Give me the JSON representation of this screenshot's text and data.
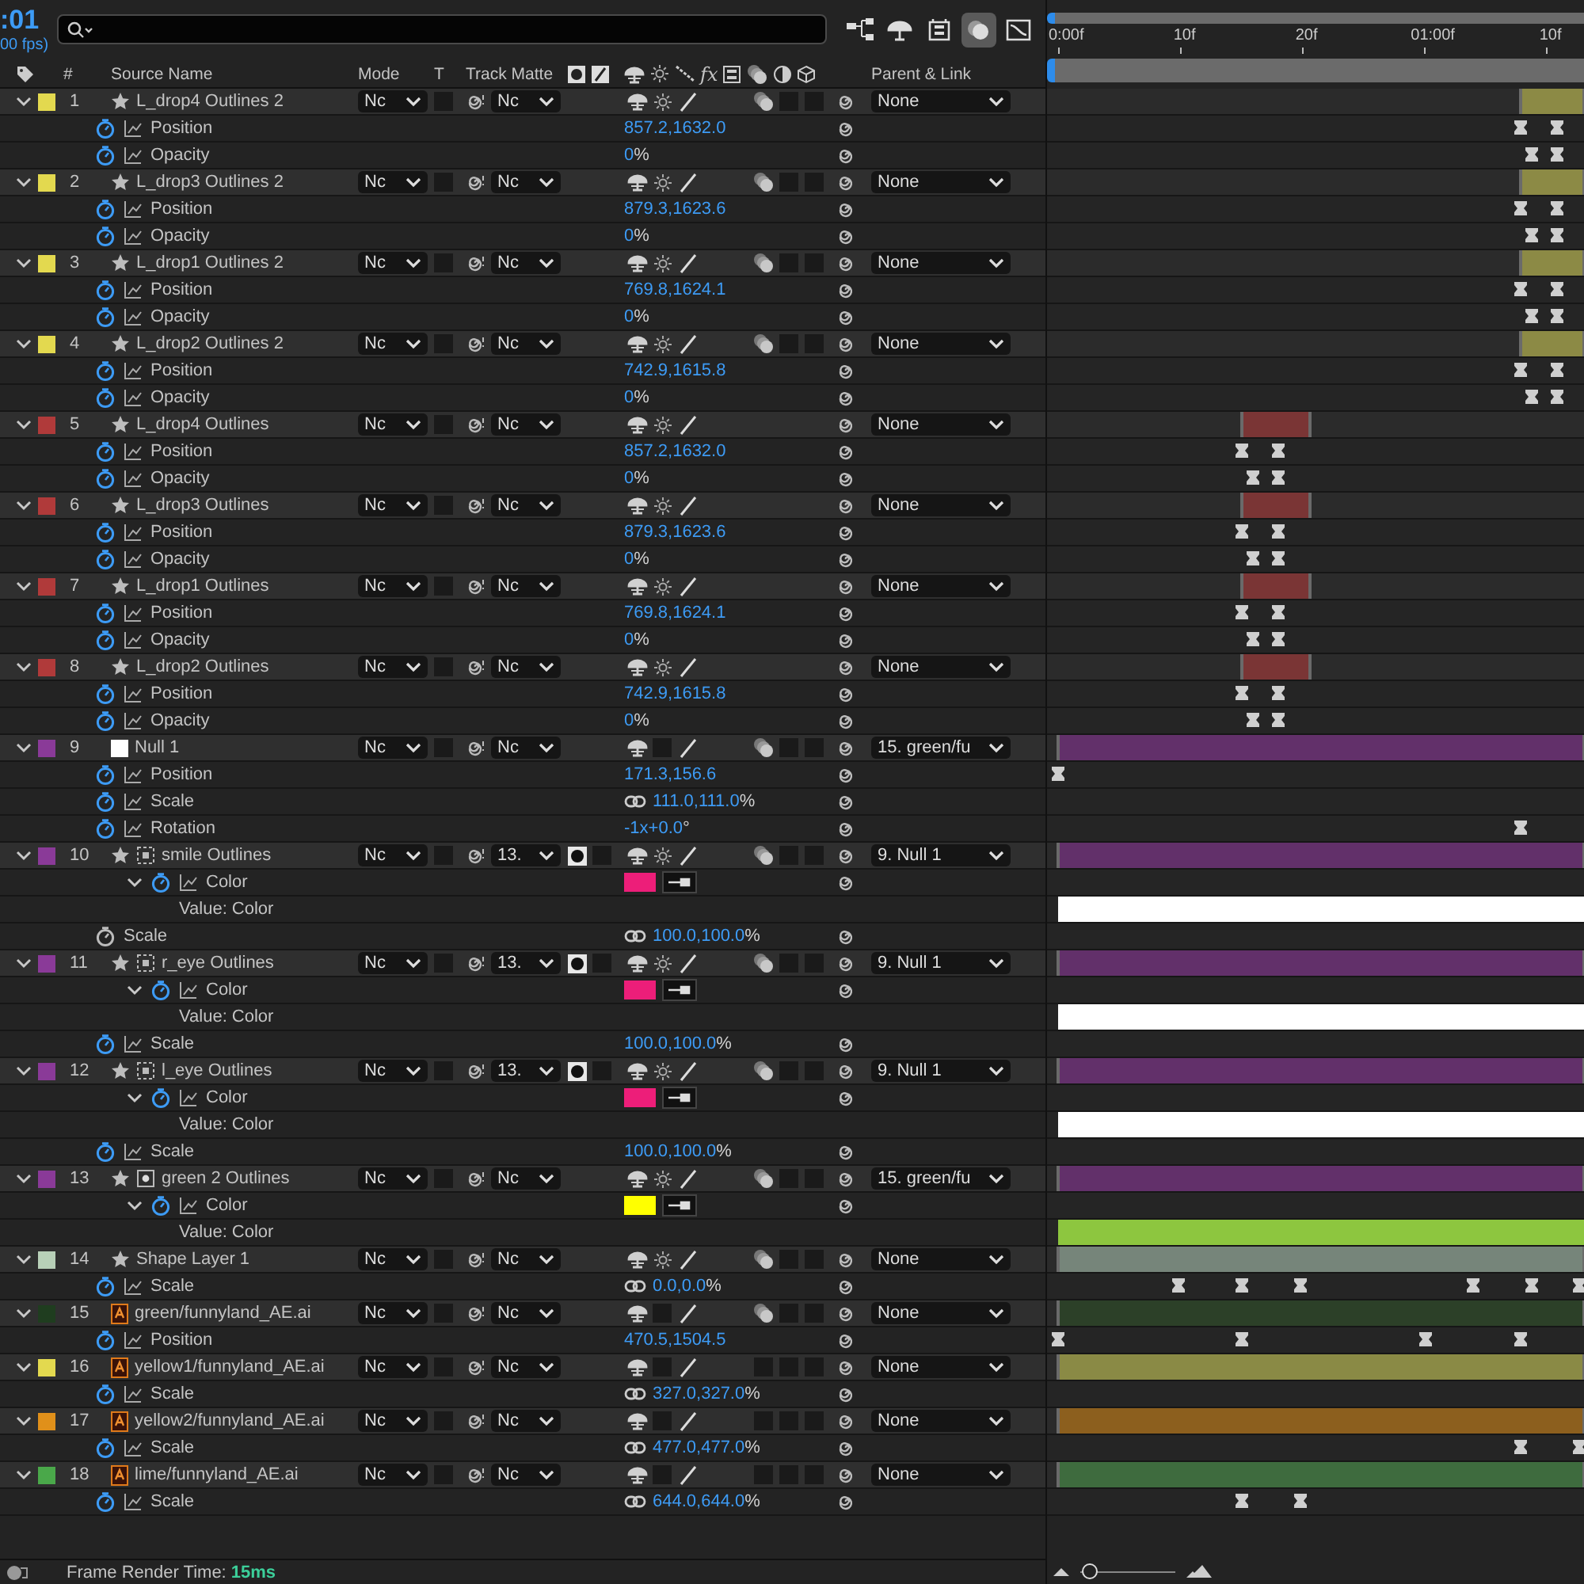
{
  "time": {
    "current": ":01",
    "fps": "00 fps)"
  },
  "toolbar": [
    {
      "selected": false
    },
    {
      "selected": false
    },
    {
      "selected": false
    },
    {
      "selected": true
    },
    {
      "selected": false
    }
  ],
  "columns": {
    "number": "#",
    "source_name": "Source Name",
    "mode": "Mode",
    "t": "T",
    "track_matte": "Track Matte",
    "fx": "fx",
    "parent": "Parent & Link"
  },
  "ruler": [
    "0:00f",
    "10f",
    "20f",
    "01:00f",
    "10f"
  ],
  "layers": [
    {
      "number": "1",
      "name": "L_drop4 Outlines 2",
      "color": "#e3d94f",
      "kind": "shape",
      "expanded": true,
      "mode": "Nc",
      "track_matte": "Nc",
      "matte_set": false,
      "collapse": true,
      "extra_switches": true,
      "motion_blur": true,
      "parent": "None",
      "bar": {
        "color": "#8c8a45",
        "in": {
          "level": 0.88
        },
        "out": {
          "level": 1
        }
      },
      "properties": [
        {
          "name": "Position",
          "kind": "property",
          "animated": true,
          "linked": false,
          "value": "857.2,1632.0",
          "keyframes": [
            {
              "level": 0.88
            },
            {
              "level": 0.95
            }
          ]
        },
        {
          "name": "Opacity",
          "kind": "property",
          "animated": true,
          "linked": false,
          "value": "0",
          "unit": "%",
          "keyframes": [
            {
              "level": 0.9
            },
            {
              "level": 0.95
            }
          ]
        }
      ]
    },
    {
      "number": "2",
      "name": "L_drop3 Outlines 2",
      "color": "#e3d94f",
      "kind": "shape",
      "expanded": true,
      "mode": "Nc",
      "track_matte": "Nc",
      "matte_set": false,
      "collapse": true,
      "extra_switches": true,
      "motion_blur": true,
      "parent": "None",
      "bar": {
        "color": "#8c8a45",
        "in": {
          "level": 0.88
        },
        "out": {
          "level": 1
        }
      },
      "properties": [
        {
          "name": "Position",
          "kind": "property",
          "animated": true,
          "linked": false,
          "value": "879.3,1623.6",
          "keyframes": [
            {
              "level": 0.88
            },
            {
              "level": 0.95
            }
          ]
        },
        {
          "name": "Opacity",
          "kind": "property",
          "animated": true,
          "linked": false,
          "value": "0",
          "unit": "%",
          "keyframes": [
            {
              "level": 0.9
            },
            {
              "level": 0.95
            }
          ]
        }
      ]
    },
    {
      "number": "3",
      "name": "L_drop1 Outlines 2",
      "color": "#e3d94f",
      "kind": "shape",
      "expanded": true,
      "mode": "Nc",
      "track_matte": "Nc",
      "matte_set": false,
      "collapse": true,
      "extra_switches": true,
      "motion_blur": true,
      "parent": "None",
      "bar": {
        "color": "#8c8a45",
        "in": {
          "level": 0.88
        },
        "out": {
          "level": 1
        }
      },
      "properties": [
        {
          "name": "Position",
          "kind": "property",
          "animated": true,
          "linked": false,
          "value": "769.8,1624.1",
          "keyframes": [
            {
              "level": 0.88
            },
            {
              "level": 0.95
            }
          ]
        },
        {
          "name": "Opacity",
          "kind": "property",
          "animated": true,
          "linked": false,
          "value": "0",
          "unit": "%",
          "keyframes": [
            {
              "level": 0.9
            },
            {
              "level": 0.95
            }
          ]
        }
      ]
    },
    {
      "number": "4",
      "name": "L_drop2 Outlines 2",
      "color": "#e3d94f",
      "kind": "shape",
      "expanded": true,
      "mode": "Nc",
      "track_matte": "Nc",
      "matte_set": false,
      "collapse": true,
      "extra_switches": true,
      "motion_blur": true,
      "parent": "None",
      "bar": {
        "color": "#8c8a45",
        "in": {
          "level": 0.88
        },
        "out": {
          "level": 1
        }
      },
      "properties": [
        {
          "name": "Position",
          "kind": "property",
          "animated": true,
          "linked": false,
          "value": "742.9,1615.8",
          "keyframes": [
            {
              "level": 0.88
            },
            {
              "level": 0.95
            }
          ]
        },
        {
          "name": "Opacity",
          "kind": "property",
          "animated": true,
          "linked": false,
          "value": "0",
          "unit": "%",
          "keyframes": [
            {
              "level": 0.9
            },
            {
              "level": 0.95
            }
          ]
        }
      ]
    },
    {
      "number": "5",
      "name": "L_drop4 Outlines",
      "color": "#b03a3a",
      "kind": "shape",
      "expanded": true,
      "mode": "Nc",
      "track_matte": "Nc",
      "matte_set": false,
      "collapse": true,
      "extra_switches": false,
      "parent": "None",
      "bar": {
        "color": "#7a3535",
        "in": {
          "level": 0.35
        },
        "out": {
          "level": 0.48
        }
      },
      "properties": [
        {
          "name": "Position",
          "kind": "property",
          "animated": true,
          "linked": false,
          "value": "857.2,1632.0",
          "keyframes": [
            {
              "level": 0.35
            },
            {
              "level": 0.42
            }
          ]
        },
        {
          "name": "Opacity",
          "kind": "property",
          "animated": true,
          "linked": false,
          "value": "0",
          "unit": "%",
          "keyframes": [
            {
              "level": 0.37
            },
            {
              "level": 0.42
            }
          ]
        }
      ]
    },
    {
      "number": "6",
      "name": "L_drop3 Outlines",
      "color": "#b03a3a",
      "kind": "shape",
      "expanded": true,
      "mode": "Nc",
      "track_matte": "Nc",
      "matte_set": false,
      "collapse": true,
      "extra_switches": false,
      "parent": "None",
      "bar": {
        "color": "#7a3535",
        "in": {
          "level": 0.35
        },
        "out": {
          "level": 0.48
        }
      },
      "properties": [
        {
          "name": "Position",
          "kind": "property",
          "animated": true,
          "linked": false,
          "value": "879.3,1623.6",
          "keyframes": [
            {
              "level": 0.35
            },
            {
              "level": 0.42
            }
          ]
        },
        {
          "name": "Opacity",
          "kind": "property",
          "animated": true,
          "linked": false,
          "value": "0",
          "unit": "%",
          "keyframes": [
            {
              "level": 0.37
            },
            {
              "level": 0.42
            }
          ]
        }
      ]
    },
    {
      "number": "7",
      "name": "L_drop1 Outlines",
      "color": "#b03a3a",
      "kind": "shape",
      "expanded": true,
      "mode": "Nc",
      "track_matte": "Nc",
      "matte_set": false,
      "collapse": true,
      "extra_switches": false,
      "parent": "None",
      "bar": {
        "color": "#7a3535",
        "in": {
          "level": 0.35
        },
        "out": {
          "level": 0.48
        }
      },
      "properties": [
        {
          "name": "Position",
          "kind": "property",
          "animated": true,
          "linked": false,
          "value": "769.8,1624.1",
          "keyframes": [
            {
              "level": 0.35
            },
            {
              "level": 0.42
            }
          ]
        },
        {
          "name": "Opacity",
          "kind": "property",
          "animated": true,
          "linked": false,
          "value": "0",
          "unit": "%",
          "keyframes": [
            {
              "level": 0.37
            },
            {
              "level": 0.42
            }
          ]
        }
      ]
    },
    {
      "number": "8",
      "name": "L_drop2 Outlines",
      "color": "#b03a3a",
      "kind": "shape",
      "expanded": true,
      "mode": "Nc",
      "track_matte": "Nc",
      "matte_set": false,
      "collapse": true,
      "extra_switches": false,
      "parent": "None",
      "bar": {
        "color": "#7a3535",
        "in": {
          "level": 0.35
        },
        "out": {
          "level": 0.48
        }
      },
      "properties": [
        {
          "name": "Position",
          "kind": "property",
          "animated": true,
          "linked": false,
          "value": "742.9,1615.8",
          "keyframes": [
            {
              "level": 0.35
            },
            {
              "level": 0.42
            }
          ]
        },
        {
          "name": "Opacity",
          "kind": "property",
          "animated": true,
          "linked": false,
          "value": "0",
          "unit": "%",
          "keyframes": [
            {
              "level": 0.37
            },
            {
              "level": 0.42
            }
          ]
        }
      ]
    },
    {
      "number": "9",
      "name": "Null 1",
      "color": "#8a3a98",
      "kind": "null",
      "expanded": true,
      "mode": "Nc",
      "track_matte": "Nc",
      "matte_set": false,
      "collapse": false,
      "extra_switches": true,
      "motion_blur": true,
      "parent": "15. green/fu",
      "bar": {
        "color": "#62306a",
        "in": {
          "level": 0
        },
        "out": {
          "level": 1
        }
      },
      "properties": [
        {
          "name": "Position",
          "kind": "property",
          "animated": true,
          "linked": false,
          "value": "171.3,156.6",
          "keyframes": [
            {
              "level": 0
            }
          ]
        },
        {
          "name": "Scale",
          "kind": "property",
          "animated": true,
          "linked": true,
          "value": "111.0,111.0",
          "unit": "%"
        },
        {
          "name": "Rotation",
          "kind": "property",
          "animated": true,
          "linked": false,
          "value": "-1x+0.0",
          "unit": "°",
          "keyframes": [
            {
              "level": 0.88
            }
          ]
        }
      ]
    },
    {
      "number": "10",
      "name": "smile Outlines",
      "color": "#8a3a98",
      "kind": "shape-alpha",
      "expanded": true,
      "mode": "Nc",
      "track_matte": "13.",
      "matte_set": true,
      "collapse": true,
      "extra_switches": true,
      "motion_blur": true,
      "parent": "9. Null 1",
      "bar": {
        "color": "#62306a",
        "in": {
          "level": 0
        },
        "out": {
          "level": 1
        }
      },
      "properties": [
        {
          "name": "Color",
          "kind": "color",
          "animated": true,
          "expanded": true,
          "color": "#ed1e79"
        },
        {
          "name": "Value: Color",
          "kind": "value-label",
          "value_bar": {
            "color": "#ffffff"
          }
        },
        {
          "name": "Scale",
          "kind": "property",
          "animated": false,
          "linked": true,
          "value": "100.0,100.0",
          "unit": "%"
        }
      ]
    },
    {
      "number": "11",
      "name": "r_eye Outlines",
      "color": "#8a3a98",
      "kind": "shape-alpha",
      "expanded": true,
      "mode": "Nc",
      "track_matte": "13.",
      "matte_set": true,
      "collapse": true,
      "extra_switches": true,
      "motion_blur": true,
      "parent": "9. Null 1",
      "bar": {
        "color": "#62306a",
        "in": {
          "level": 0
        },
        "out": {
          "level": 1
        }
      },
      "properties": [
        {
          "name": "Color",
          "kind": "color",
          "animated": true,
          "expanded": true,
          "color": "#ed1e79"
        },
        {
          "name": "Value: Color",
          "kind": "value-label",
          "value_bar": {
            "color": "#ffffff"
          }
        },
        {
          "name": "Scale",
          "kind": "property",
          "animated": true,
          "linked": false,
          "value": "100.0,100.0",
          "unit": "%"
        }
      ]
    },
    {
      "number": "12",
      "name": "l_eye Outlines",
      "color": "#8a3a98",
      "kind": "shape-alpha",
      "expanded": true,
      "mode": "Nc",
      "track_matte": "13.",
      "matte_set": true,
      "collapse": true,
      "extra_switches": true,
      "motion_blur": true,
      "parent": "9. Null 1",
      "bar": {
        "color": "#62306a",
        "in": {
          "level": 0
        },
        "out": {
          "level": 1
        }
      },
      "properties": [
        {
          "name": "Color",
          "kind": "color",
          "animated": true,
          "expanded": true,
          "color": "#ed1e79"
        },
        {
          "name": "Value: Color",
          "kind": "value-label",
          "value_bar": {
            "color": "#ffffff"
          }
        },
        {
          "name": "Scale",
          "kind": "property",
          "animated": true,
          "linked": false,
          "value": "100.0,100.0",
          "unit": "%"
        }
      ]
    },
    {
      "number": "13",
      "name": "green 2 Outlines",
      "color": "#8a3a98",
      "kind": "shape-matte",
      "expanded": true,
      "mode": "Nc",
      "track_matte": "Nc",
      "matte_set": false,
      "collapse": true,
      "extra_switches": true,
      "motion_blur": true,
      "parent": "15. green/fu",
      "bar": {
        "color": "#62306a",
        "in": {
          "level": 0
        },
        "out": {
          "level": 1
        }
      },
      "properties": [
        {
          "name": "Color",
          "kind": "color",
          "animated": true,
          "expanded": true,
          "color": "#ffff00"
        },
        {
          "name": "Value: Color",
          "kind": "value-label",
          "value_bar": {
            "color": "#8dc63f"
          }
        }
      ]
    },
    {
      "number": "14",
      "name": "Shape Layer 1",
      "color": "#b8d0b8",
      "kind": "shape",
      "expanded": true,
      "mode": "Nc",
      "track_matte": "Nc",
      "matte_set": false,
      "collapse": true,
      "extra_switches": true,
      "motion_blur": true,
      "parent": "None",
      "bar": {
        "color": "#76857a",
        "in": {
          "level": 0
        },
        "out": {
          "level": 1
        }
      },
      "properties": [
        {
          "name": "Scale",
          "kind": "property",
          "animated": true,
          "linked": true,
          "value": "0.0,0.0",
          "unit": "%",
          "keyframes": [
            {
              "level": 0.23
            },
            {
              "level": 0.35
            },
            {
              "level": 0.46
            },
            {
              "level": 0.79
            },
            {
              "level": 0.9
            },
            {
              "level": 0.99
            }
          ]
        }
      ]
    },
    {
      "number": "15",
      "name": "green/funnyland_AE.ai",
      "color": "#1f3d1f",
      "kind": "footage",
      "expanded": true,
      "mode": "Nc",
      "track_matte": "Nc",
      "matte_set": false,
      "collapse": false,
      "extra_switches": true,
      "motion_blur": true,
      "parent": "None",
      "bar": {
        "color": "#2c4028",
        "in": {
          "level": 0
        },
        "out": {
          "level": 1
        }
      },
      "properties": [
        {
          "name": "Position",
          "kind": "property",
          "animated": true,
          "linked": false,
          "value": "470.5,1504.5",
          "keyframes": [
            {
              "level": 0
            },
            {
              "level": 0.35
            },
            {
              "level": 0.7
            },
            {
              "level": 0.88
            }
          ]
        }
      ]
    },
    {
      "number": "16",
      "name": "yellow1/funnyland_AE.ai",
      "color": "#e3d94f",
      "kind": "footage",
      "expanded": true,
      "mode": "Nc",
      "track_matte": "Nc",
      "matte_set": false,
      "collapse": false,
      "extra_switches": true,
      "motion_blur": false,
      "parent": "None",
      "bar": {
        "color": "#8a8a45",
        "in": {
          "level": 0
        },
        "out": {
          "level": 1
        }
      },
      "properties": [
        {
          "name": "Scale",
          "kind": "property",
          "animated": true,
          "linked": true,
          "value": "327.0,327.0",
          "unit": "%"
        }
      ]
    },
    {
      "number": "17",
      "name": "yellow2/funnyland_AE.ai",
      "color": "#e0901a",
      "kind": "footage",
      "expanded": true,
      "mode": "Nc",
      "track_matte": "Nc",
      "matte_set": false,
      "collapse": false,
      "extra_switches": true,
      "motion_blur": false,
      "parent": "None",
      "bar": {
        "color": "#8c5f1e",
        "in": {
          "level": 0
        },
        "out": {
          "level": 1
        }
      },
      "properties": [
        {
          "name": "Scale",
          "kind": "property",
          "animated": true,
          "linked": true,
          "value": "477.0,477.0",
          "unit": "%",
          "keyframes": [
            {
              "level": 0.88
            },
            {
              "level": 0.99
            }
          ]
        }
      ]
    },
    {
      "number": "18",
      "name": "lime/funnyland_AE.ai",
      "color": "#4aa84a",
      "kind": "footage",
      "expanded": true,
      "mode": "Nc",
      "track_matte": "Nc",
      "matte_set": false,
      "collapse": false,
      "extra_switches": true,
      "motion_blur": false,
      "parent": "None",
      "bar": {
        "color": "#3e6b3e",
        "in": {
          "level": 0
        },
        "out": {
          "level": 1
        }
      },
      "properties": [
        {
          "name": "Scale",
          "kind": "property",
          "animated": true,
          "linked": true,
          "value": "644.0,644.0",
          "unit": "%",
          "keyframes": [
            {
              "level": 0.35
            },
            {
              "level": 0.46
            }
          ]
        }
      ]
    }
  ],
  "status_bar": {
    "label": "Frame Render Time:",
    "value": "15ms"
  },
  "zoom": {
    "level": 0.1
  }
}
